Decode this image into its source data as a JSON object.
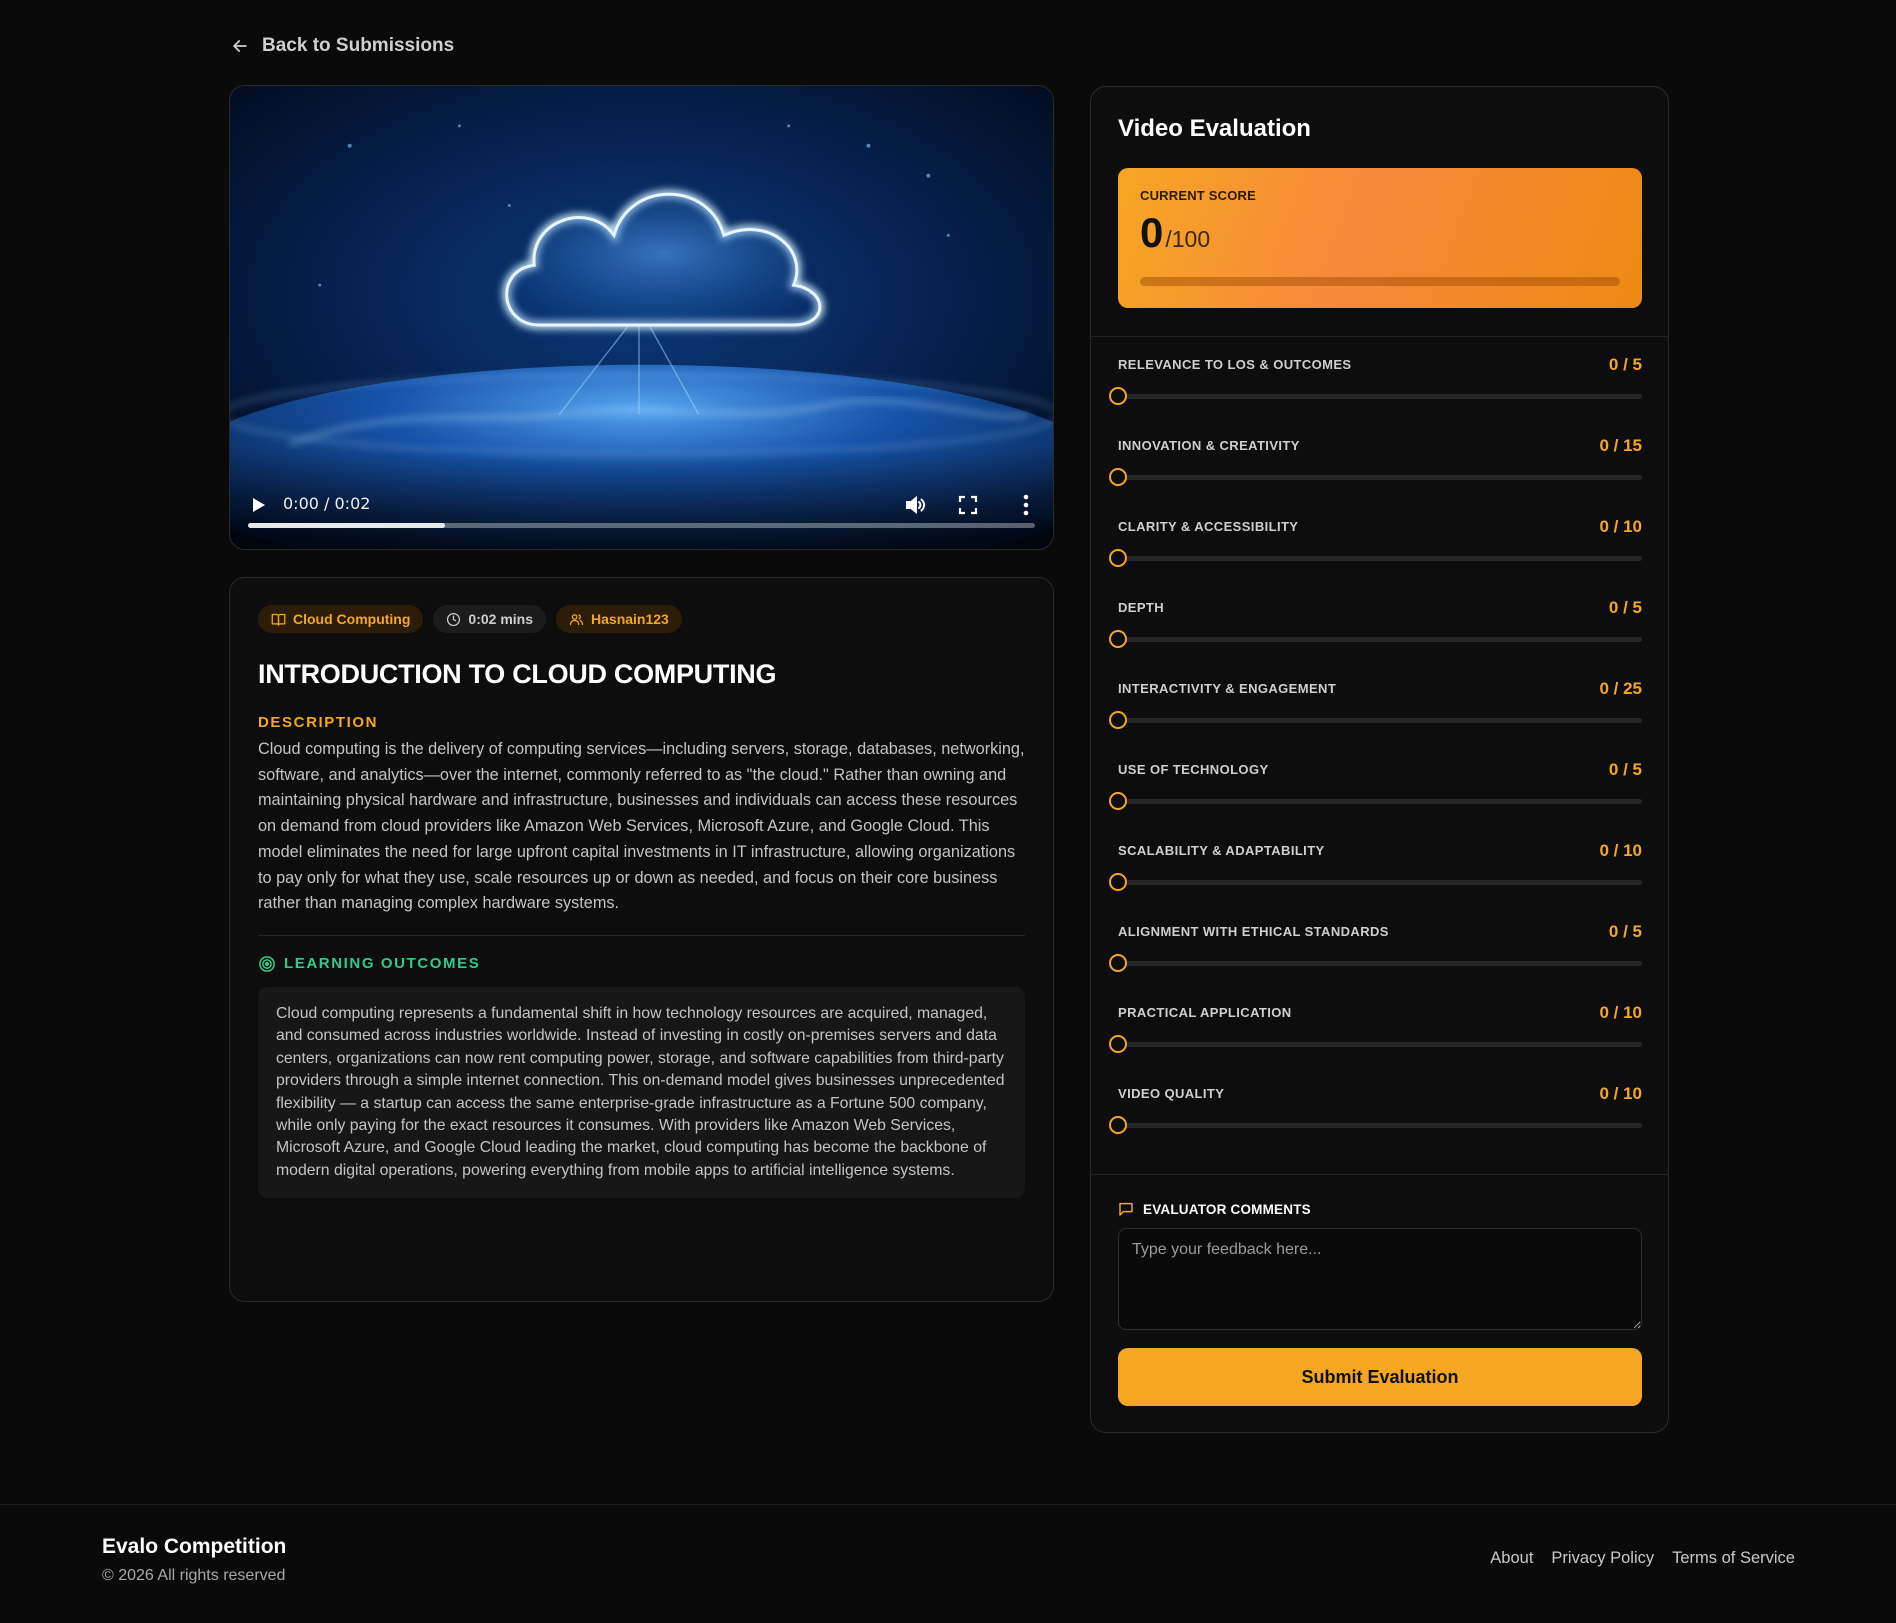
{
  "nav": {
    "back_label": "Back to Submissions"
  },
  "video": {
    "time_display": "0:00 / 0:02",
    "progress_buffered": 0.25
  },
  "info": {
    "badges": {
      "topic": "Cloud Computing",
      "duration": "0:02 mins",
      "author": "Hasnain123"
    },
    "title": "INTRODUCTION TO CLOUD COMPUTING",
    "description_label": "DESCRIPTION",
    "description": "Cloud computing is the delivery of computing services—including servers, storage, databases, networking, software, and analytics—over the internet, commonly referred to as \"the cloud.\" Rather than owning and maintaining physical hardware and infrastructure, businesses and individuals can access these resources on demand from cloud providers like Amazon Web Services, Microsoft Azure, and Google Cloud. This model eliminates the need for large upfront capital investments in IT infrastructure, allowing organizations to pay only for what they use, scale resources up or down as needed, and focus on their core business rather than managing complex hardware systems.",
    "learning_outcomes_label": "LEARNING OUTCOMES",
    "learning_outcomes": "Cloud computing represents a fundamental shift in how technology resources are acquired, managed, and consumed across industries worldwide. Instead of investing in costly on-premises servers and data centers, organizations can now rent computing power, storage, and software capabilities from third-party providers through a simple internet connection. This on-demand model gives businesses unprecedented flexibility — a startup can access the same enterprise-grade infrastructure as a Fortune 500 company, while only paying for the exact resources it consumes. With providers like Amazon Web Services, Microsoft Azure, and Google Cloud leading the market, cloud computing has become the backbone of modern digital operations, powering everything from mobile apps to artificial intelligence systems."
  },
  "evaluation": {
    "title": "Video Evaluation",
    "score_label": "CURRENT SCORE",
    "score_value": "0",
    "score_max": "/100",
    "score_fraction": 0,
    "criteria": [
      {
        "name": "RELEVANCE TO LOS & OUTCOMES",
        "score": "0 / 5",
        "value": 0,
        "max": 5
      },
      {
        "name": "INNOVATION & CREATIVITY",
        "score": "0 / 15",
        "value": 0,
        "max": 15
      },
      {
        "name": "CLARITY & ACCESSIBILITY",
        "score": "0 / 10",
        "value": 0,
        "max": 10
      },
      {
        "name": "DEPTH",
        "score": "0 / 5",
        "value": 0,
        "max": 5
      },
      {
        "name": "INTERACTIVITY & ENGAGEMENT",
        "score": "0 / 25",
        "value": 0,
        "max": 25
      },
      {
        "name": "USE OF TECHNOLOGY",
        "score": "0 / 5",
        "value": 0,
        "max": 5
      },
      {
        "name": "SCALABILITY & ADAPTABILITY",
        "score": "0 / 10",
        "value": 0,
        "max": 10
      },
      {
        "name": "ALIGNMENT WITH ETHICAL STANDARDS",
        "score": "0 / 5",
        "value": 0,
        "max": 5
      },
      {
        "name": "PRACTICAL APPLICATION",
        "score": "0 / 10",
        "value": 0,
        "max": 10
      },
      {
        "name": "VIDEO QUALITY",
        "score": "0 / 10",
        "value": 0,
        "max": 10
      }
    ],
    "comments_label": "EVALUATOR COMMENTS",
    "comments_placeholder": "Type your feedback here...",
    "comments_value": "",
    "submit_label": "Submit Evaluation"
  },
  "footer": {
    "brand": "Evalo Competition",
    "copyright": "© 2026 All rights reserved",
    "links": [
      "About",
      "Privacy Policy",
      "Terms of Service"
    ]
  },
  "colors": {
    "accent": "#f5a623",
    "success": "#2ecc8a",
    "background": "#0a0a0a"
  },
  "icons": {
    "back": "arrow-left-icon",
    "topic": "book-open-icon",
    "duration": "clock-icon",
    "author": "users-icon",
    "outcomes": "target-icon",
    "comments": "message-square-icon",
    "play": "play-icon",
    "volume": "volume-icon",
    "fullscreen": "fullscreen-icon",
    "more": "more-vertical-icon"
  }
}
